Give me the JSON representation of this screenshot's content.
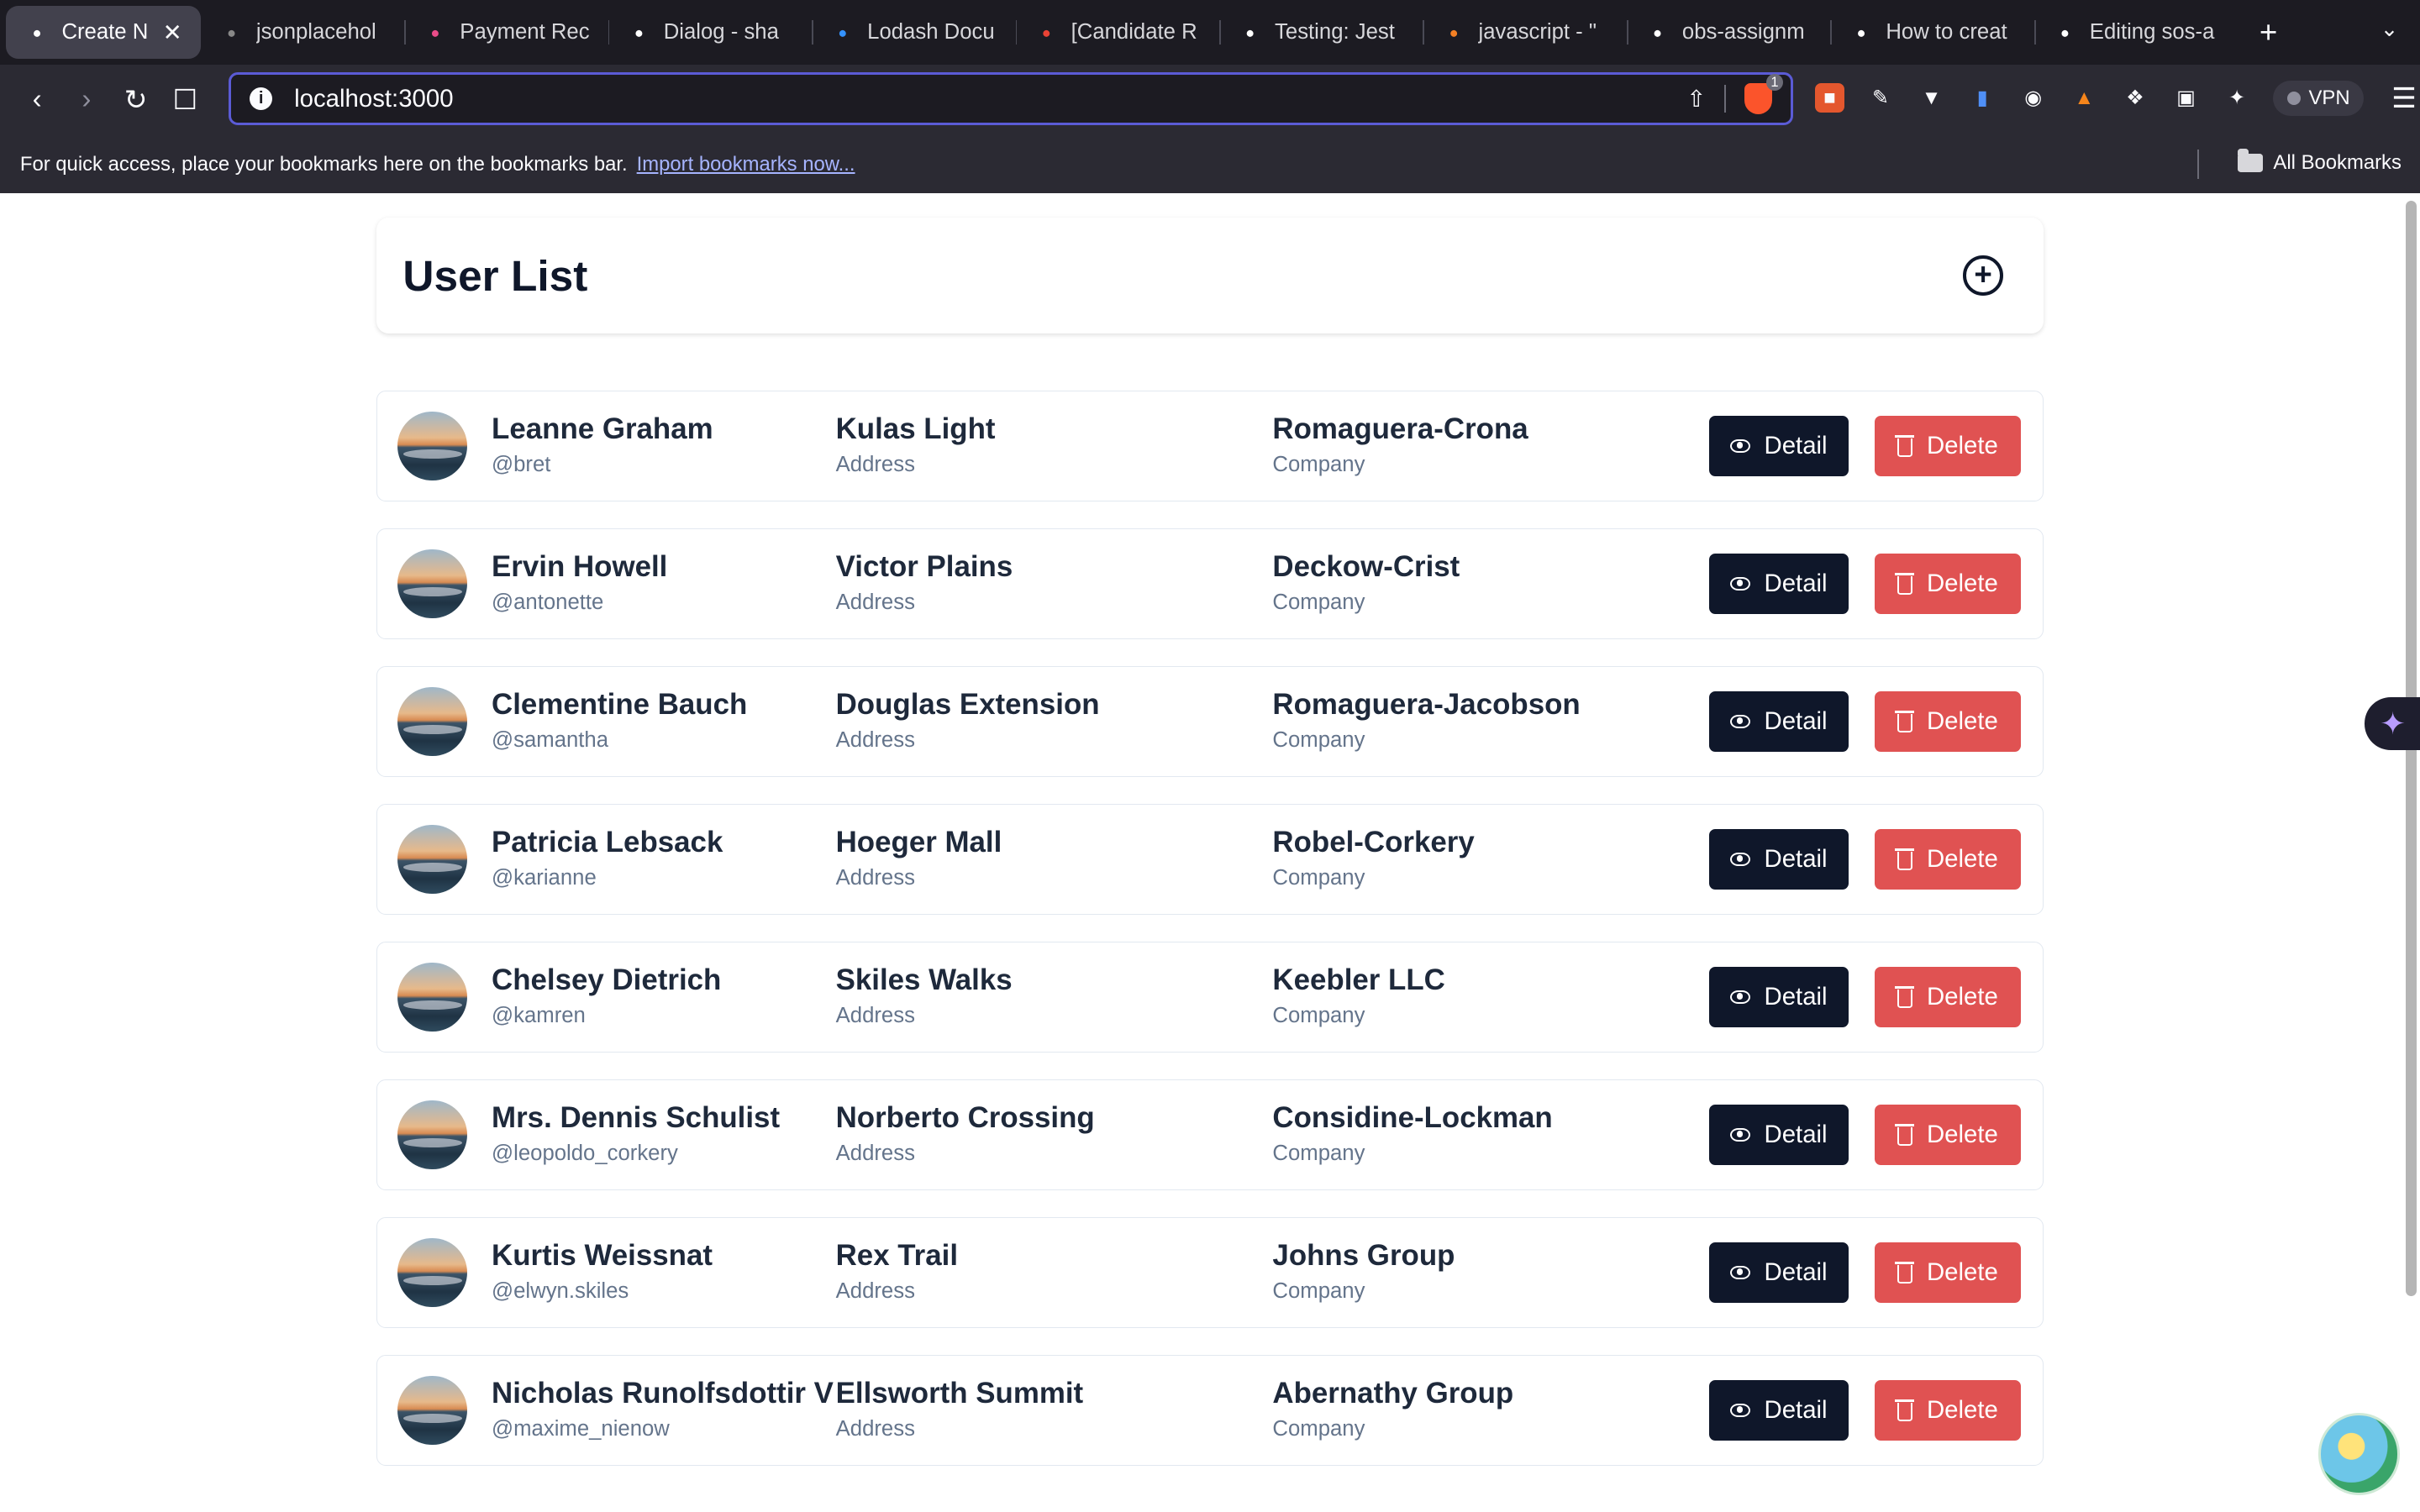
{
  "browser": {
    "tabs": [
      {
        "title": "Create N",
        "icon": "vercel-triangle-icon",
        "color": "#ffffff",
        "active": true
      },
      {
        "title": "jsonplacehol",
        "icon": "globe-icon",
        "color": "#888888"
      },
      {
        "title": "Payment Rec",
        "icon": "dribbble-icon",
        "color": "#ea4c89"
      },
      {
        "title": "Dialog - sha",
        "icon": "shadcn-icon",
        "color": "#ffffff"
      },
      {
        "title": "Lodash Docu",
        "icon": "lodash-icon",
        "color": "#3492ff"
      },
      {
        "title": "[Candidate R",
        "icon": "gmail-icon",
        "color": "#ea4335"
      },
      {
        "title": "Testing: Jest",
        "icon": "nextjs-icon",
        "color": "#ffffff"
      },
      {
        "title": "javascript - \"",
        "icon": "stackoverflow-icon",
        "color": "#f48024"
      },
      {
        "title": "obs-assignm",
        "icon": "github-icon",
        "color": "#ffffff"
      },
      {
        "title": "How to creat",
        "icon": "dev-icon",
        "color": "#ffffff"
      },
      {
        "title": "Editing sos-a",
        "icon": "github-icon",
        "color": "#ffffff"
      }
    ],
    "url": "localhost:3000",
    "shield_badge": "1",
    "vpn_label": "VPN",
    "bookmarks_text": "For quick access, place your bookmarks here on the bookmarks bar.",
    "bookmarks_link": "Import bookmarks now...",
    "all_bookmarks": "All Bookmarks"
  },
  "page": {
    "title": "User List",
    "detail_label": "Detail",
    "delete_label": "Delete",
    "address_caption": "Address",
    "company_caption": "Company",
    "users": [
      {
        "name": "Leanne Graham",
        "username": "@bret",
        "street": "Kulas Light",
        "company": "Romaguera-Crona"
      },
      {
        "name": "Ervin Howell",
        "username": "@antonette",
        "street": "Victor Plains",
        "company": "Deckow-Crist"
      },
      {
        "name": "Clementine Bauch",
        "username": "@samantha",
        "street": "Douglas Extension",
        "company": "Romaguera-Jacobson"
      },
      {
        "name": "Patricia Lebsack",
        "username": "@karianne",
        "street": "Hoeger Mall",
        "company": "Robel-Corkery"
      },
      {
        "name": "Chelsey Dietrich",
        "username": "@kamren",
        "street": "Skiles Walks",
        "company": "Keebler LLC"
      },
      {
        "name": "Mrs. Dennis Schulist",
        "username": "@leopoldo_corkery",
        "street": "Norberto Crossing",
        "company": "Considine-Lockman"
      },
      {
        "name": "Kurtis Weissnat",
        "username": "@elwyn.skiles",
        "street": "Rex Trail",
        "company": "Johns Group"
      },
      {
        "name": "Nicholas Runolfsdottir V",
        "username": "@maxime_nienow",
        "street": "Ellsworth Summit",
        "company": "Abernathy Group"
      }
    ]
  },
  "colors": {
    "primary_button": "#0f172a",
    "danger_button": "#e05252",
    "url_focus_ring": "#5b5bd6"
  }
}
